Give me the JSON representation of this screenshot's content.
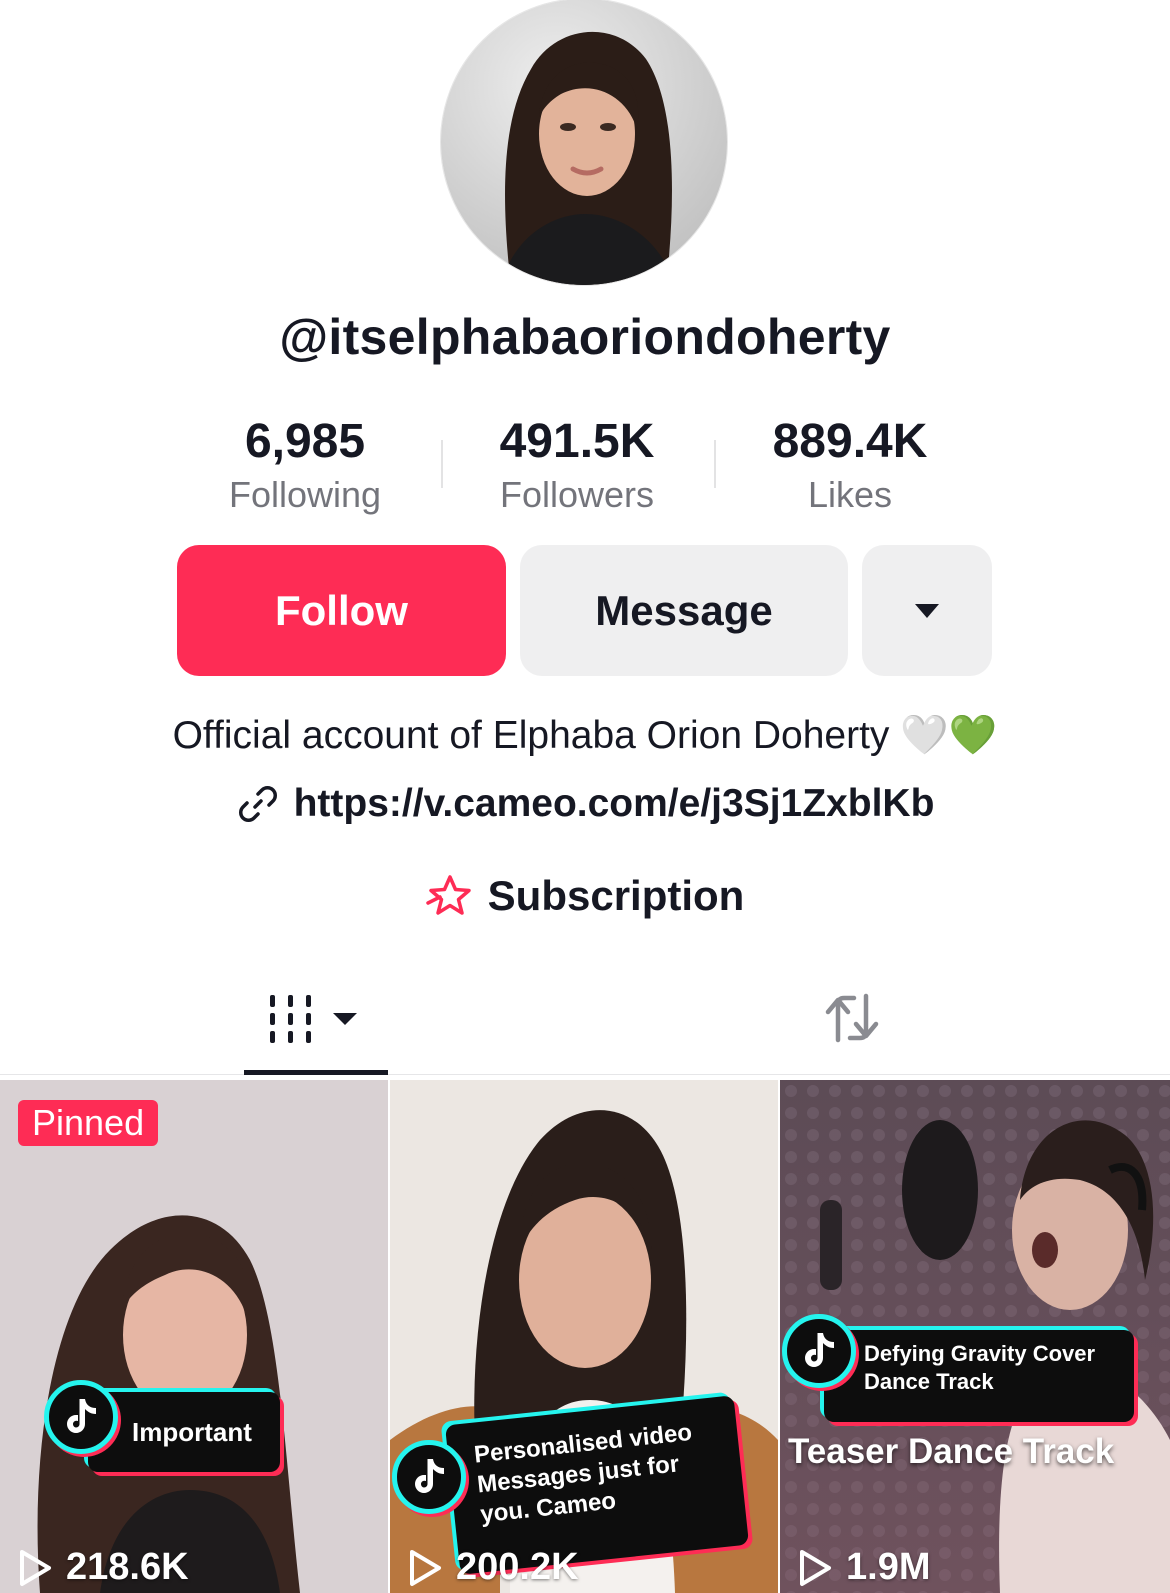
{
  "profile": {
    "username": "@itselphabaoriondoherty",
    "stats": {
      "following": {
        "value": "6,985",
        "label": "Following"
      },
      "followers": {
        "value": "491.5K",
        "label": "Followers"
      },
      "likes": {
        "value": "889.4K",
        "label": "Likes"
      }
    },
    "bio": "Official account of Elphaba Orion Doherty 🤍💚",
    "link": "https://v.cameo.com/e/j3Sj1ZxblKb",
    "subscription_label": "Subscription"
  },
  "actions": {
    "follow_label": "Follow",
    "message_label": "Message",
    "more_icon": "caret-down-icon"
  },
  "tabs": {
    "videos_icon": "grid-columns-icon",
    "reposts_icon": "repost-icon"
  },
  "videos": [
    {
      "pinned_label": "Pinned",
      "sticker": "Important",
      "views": "218.6K"
    },
    {
      "sticker": "Personalised video Messages just for you. Cameo",
      "views": "200.2K"
    },
    {
      "sticker": "Defying Gravity Cover Dance Track",
      "overlay": "Teaser Dance Track",
      "views": "1.9M"
    }
  ],
  "colors": {
    "accent": "#fe2c55",
    "button_gray": "#efeff0",
    "text_primary": "#161823",
    "text_secondary": "#73747b",
    "tiktok_cyan": "#25f4ee"
  }
}
